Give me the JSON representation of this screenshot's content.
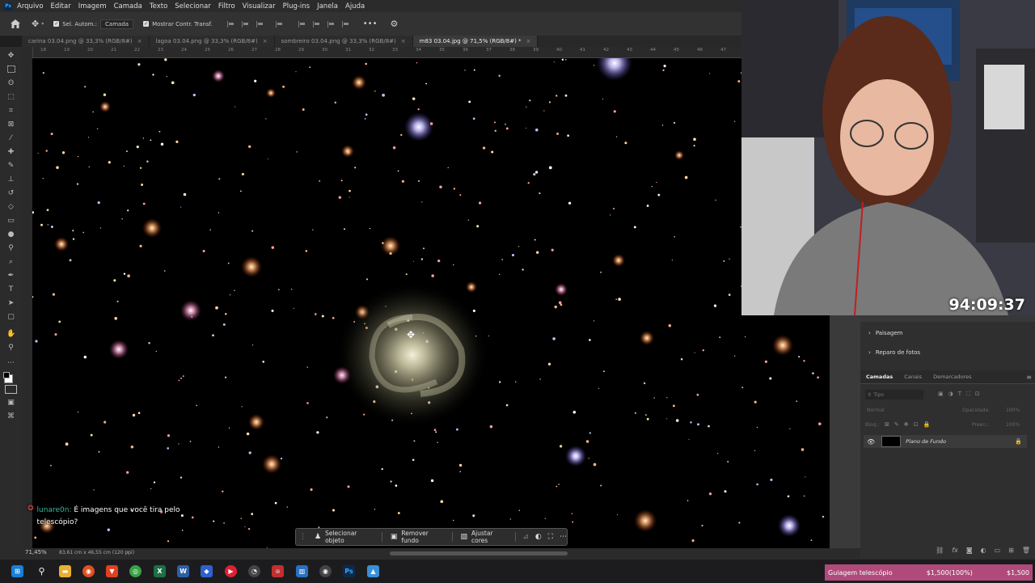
{
  "menu": {
    "logo": "Ps",
    "items": [
      "Arquivo",
      "Editar",
      "Imagem",
      "Camada",
      "Texto",
      "Selecionar",
      "Filtro",
      "Visualizar",
      "Plug-ins",
      "Janela",
      "Ajuda"
    ]
  },
  "options": {
    "auto_select_label": "Sel. Autom.:",
    "auto_select_value": "Camada",
    "show_transform_label": "Mostrar Contr. Transf."
  },
  "tabs": [
    {
      "label": "carina 03.04.png @ 33,3% (RGB/8#)",
      "active": false
    },
    {
      "label": "lagoa 03.04.png @ 33,3% (RGB/8#)",
      "active": false
    },
    {
      "label": "sombreiro 03.04.png @ 33,3% (RGB/8#)",
      "active": false
    },
    {
      "label": "m83 03.04.jpg @ 71,5% (RGB/8#) *",
      "active": true
    }
  ],
  "ruler_ticks": [
    "18",
    "19",
    "20",
    "21",
    "22",
    "23",
    "24",
    "25",
    "26",
    "27",
    "28",
    "29",
    "30",
    "31",
    "32",
    "33",
    "34",
    "35",
    "36",
    "37",
    "38",
    "39",
    "40",
    "41",
    "42",
    "43",
    "44",
    "45",
    "46",
    "47"
  ],
  "status": {
    "zoom": "71,45%",
    "doc_size": "83,61 cm x 46,55 cm (120 ppi)"
  },
  "context_bar": {
    "select_object": "Selecionar objeto",
    "remove_bg": "Remover fundo",
    "adjust_colors": "Ajustar cores"
  },
  "chat": {
    "username": "lunare0n:",
    "message": "É imagens que você tira pelo telescópio?"
  },
  "webcam": {
    "timer": "94:09:37"
  },
  "panel": {
    "items": [
      "Paisagem",
      "Reparo de fotos"
    ],
    "tabs": [
      "Camadas",
      "Canais",
      "Demarcadores"
    ],
    "filter_placeholder": "Tipo",
    "blend_mode": "Normal",
    "opacity_label": "Opacidade:",
    "opacity_value": "100%",
    "lock_label": "Bloq.:",
    "fill_label": "Preen.:",
    "fill_value": "100%",
    "layer_name": "Plano de Fundo"
  },
  "goal": {
    "label": "Guiagem telescópio",
    "progress_text": "$1,500(100%)",
    "target": "$1,500",
    "progress": 1.0,
    "color": "#b04a7a"
  },
  "colors": {
    "accent": "#31a8ff",
    "app_bg": "#323232"
  }
}
